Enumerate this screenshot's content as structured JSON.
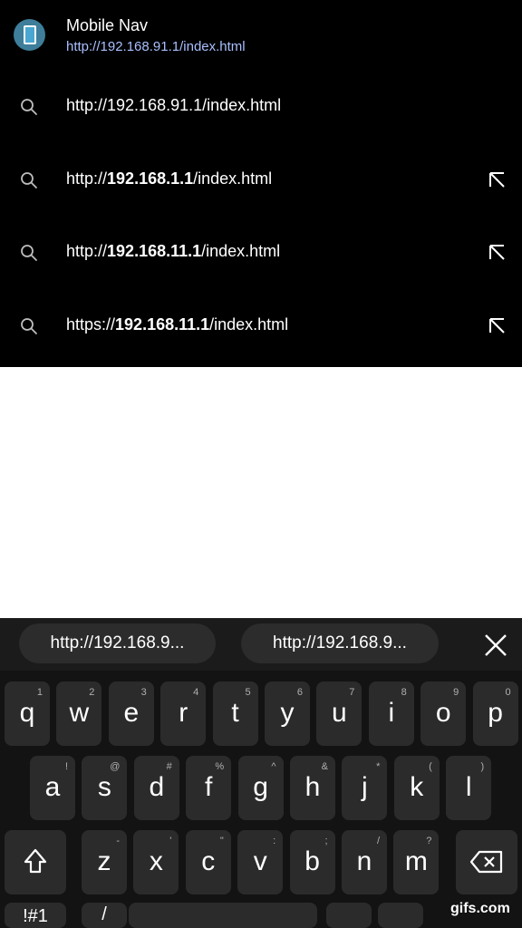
{
  "bookmark": {
    "title": "Mobile Nav",
    "url": "http://192.168.91.1/index.html",
    "icon": "mobile-phone-icon"
  },
  "suggestions": [
    {
      "prefix": "http://192.168.91.1/index.html",
      "bold": "",
      "suffix": "",
      "has_fill": false
    },
    {
      "prefix": "http://",
      "bold": "192.168.1.1",
      "suffix": "/index.html",
      "has_fill": true
    },
    {
      "prefix": "http://",
      "bold": "192.168.11.1",
      "suffix": "/index.html",
      "has_fill": true
    },
    {
      "prefix": "https://",
      "bold": "192.168.11.1",
      "suffix": "/index.html",
      "has_fill": true
    }
  ],
  "keyboard": {
    "chips": [
      "http://192.168.9...",
      "http://192.168.9..."
    ],
    "row1": [
      {
        "k": "q",
        "h": "1"
      },
      {
        "k": "w",
        "h": "2"
      },
      {
        "k": "e",
        "h": "3"
      },
      {
        "k": "r",
        "h": "4"
      },
      {
        "k": "t",
        "h": "5"
      },
      {
        "k": "y",
        "h": "6"
      },
      {
        "k": "u",
        "h": "7"
      },
      {
        "k": "i",
        "h": "8"
      },
      {
        "k": "o",
        "h": "9"
      },
      {
        "k": "p",
        "h": "0"
      }
    ],
    "row2": [
      {
        "k": "a",
        "h": "!"
      },
      {
        "k": "s",
        "h": "@"
      },
      {
        "k": "d",
        "h": "#"
      },
      {
        "k": "f",
        "h": "%"
      },
      {
        "k": "g",
        "h": "^"
      },
      {
        "k": "h",
        "h": "&"
      },
      {
        "k": "j",
        "h": "*"
      },
      {
        "k": "k",
        "h": "("
      },
      {
        "k": "l",
        "h": ")"
      }
    ],
    "row3": [
      {
        "k": "z",
        "h": "-"
      },
      {
        "k": "x",
        "h": "'"
      },
      {
        "k": "c",
        "h": "\""
      },
      {
        "k": "v",
        "h": ":"
      },
      {
        "k": "b",
        "h": ";"
      },
      {
        "k": "n",
        "h": "/"
      },
      {
        "k": "m",
        "h": "?"
      }
    ],
    "bottom_left": "!#1",
    "bottom_slash": "/"
  },
  "watermark": "gifs.com",
  "colors": {
    "link": "#a9bfff",
    "keyboard_bg": "#131313",
    "key_bg": "#2b2b2b"
  }
}
